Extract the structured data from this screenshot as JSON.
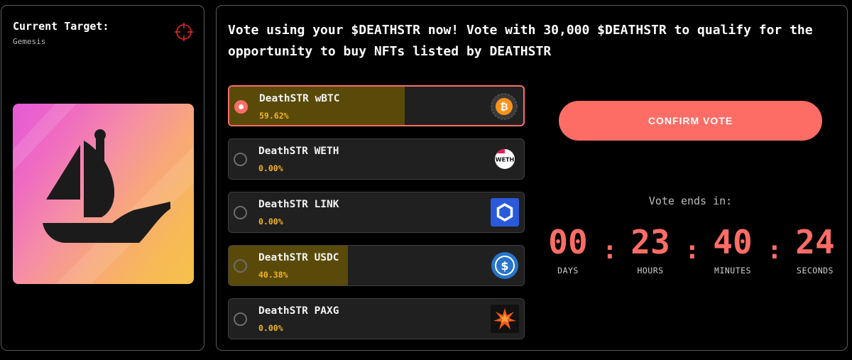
{
  "target": {
    "label": "Current Target:",
    "name": "Gemesis",
    "crosshair_icon": "crosshair-icon",
    "art_icon": "opensea-ship-icon"
  },
  "vote": {
    "heading": "Vote using your $DEATHSTR now! Vote with 30,000 $DEATHSTR to qualify for the opportunity to buy NFTs listed by DEATHSTR",
    "options": [
      {
        "name": "DeathSTR wBTC",
        "percent": "59.62%",
        "fill_fraction": 0.5962,
        "selected": true,
        "icon": "bitcoin-icon"
      },
      {
        "name": "DeathSTR WETH",
        "percent": "0.00%",
        "fill_fraction": 0,
        "selected": false,
        "icon": "weth-icon",
        "icon_text": "WETH"
      },
      {
        "name": "DeathSTR LINK",
        "percent": "0.00%",
        "fill_fraction": 0,
        "selected": false,
        "icon": "chainlink-icon"
      },
      {
        "name": "DeathSTR USDC",
        "percent": "40.38%",
        "fill_fraction": 0.4038,
        "selected": false,
        "icon": "usdc-icon"
      },
      {
        "name": "DeathSTR PAXG",
        "percent": "0.00%",
        "fill_fraction": 0,
        "selected": false,
        "icon": "paxg-icon"
      }
    ],
    "confirm_label": "CONFIRM VOTE"
  },
  "timer": {
    "ends_label": "Vote ends in:",
    "days": "00",
    "days_label": "DAYS",
    "hours": "23",
    "hours_label": "HOURS",
    "minutes": "40",
    "minutes_label": "MINUTES",
    "seconds": "24",
    "seconds_label": "SECONDS",
    "separator": ":"
  },
  "colors": {
    "accent": "#fd6d66",
    "percent": "#f1b428",
    "fill": "#5a4a0a",
    "option_bg": "#202020"
  }
}
